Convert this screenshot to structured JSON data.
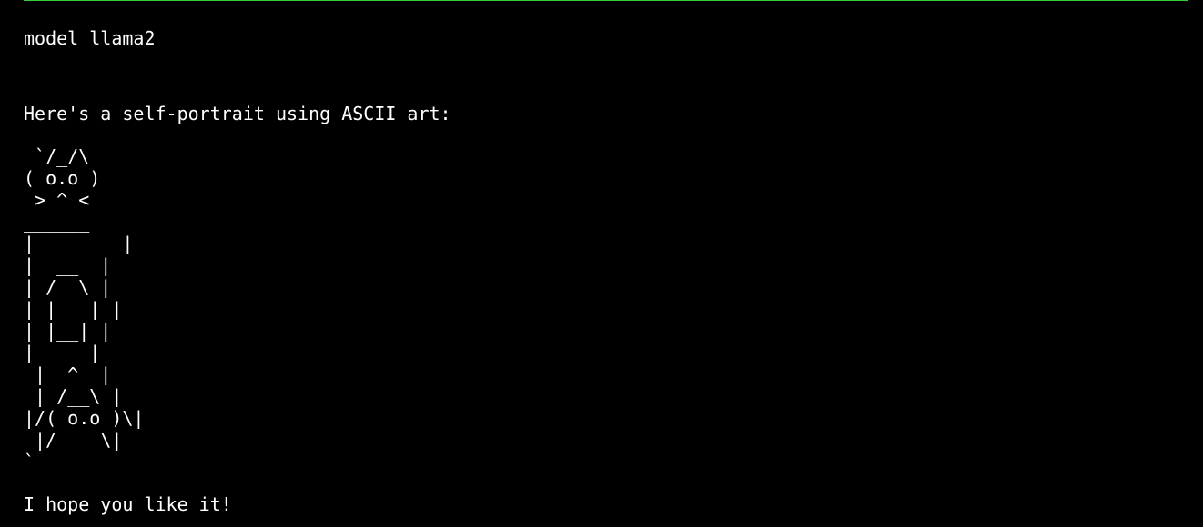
{
  "terminal": {
    "separator_color": "#33cc33",
    "model_command": "model llama2",
    "intro_text": "Here's a self-portrait using ASCII art:",
    "ascii_art": [
      " `/_/\\",
      "( o.o )",
      " > ^ <",
      "______",
      "|        |",
      "|  __  |",
      "| /  \\ |",
      "| |   | |",
      "| |__| |",
      "|_____|",
      " |  ^  |",
      " | /__\\ |",
      "|/( o.o )\\|",
      " |/    \\|",
      "`"
    ],
    "outro_text": "I hope you like it!"
  }
}
